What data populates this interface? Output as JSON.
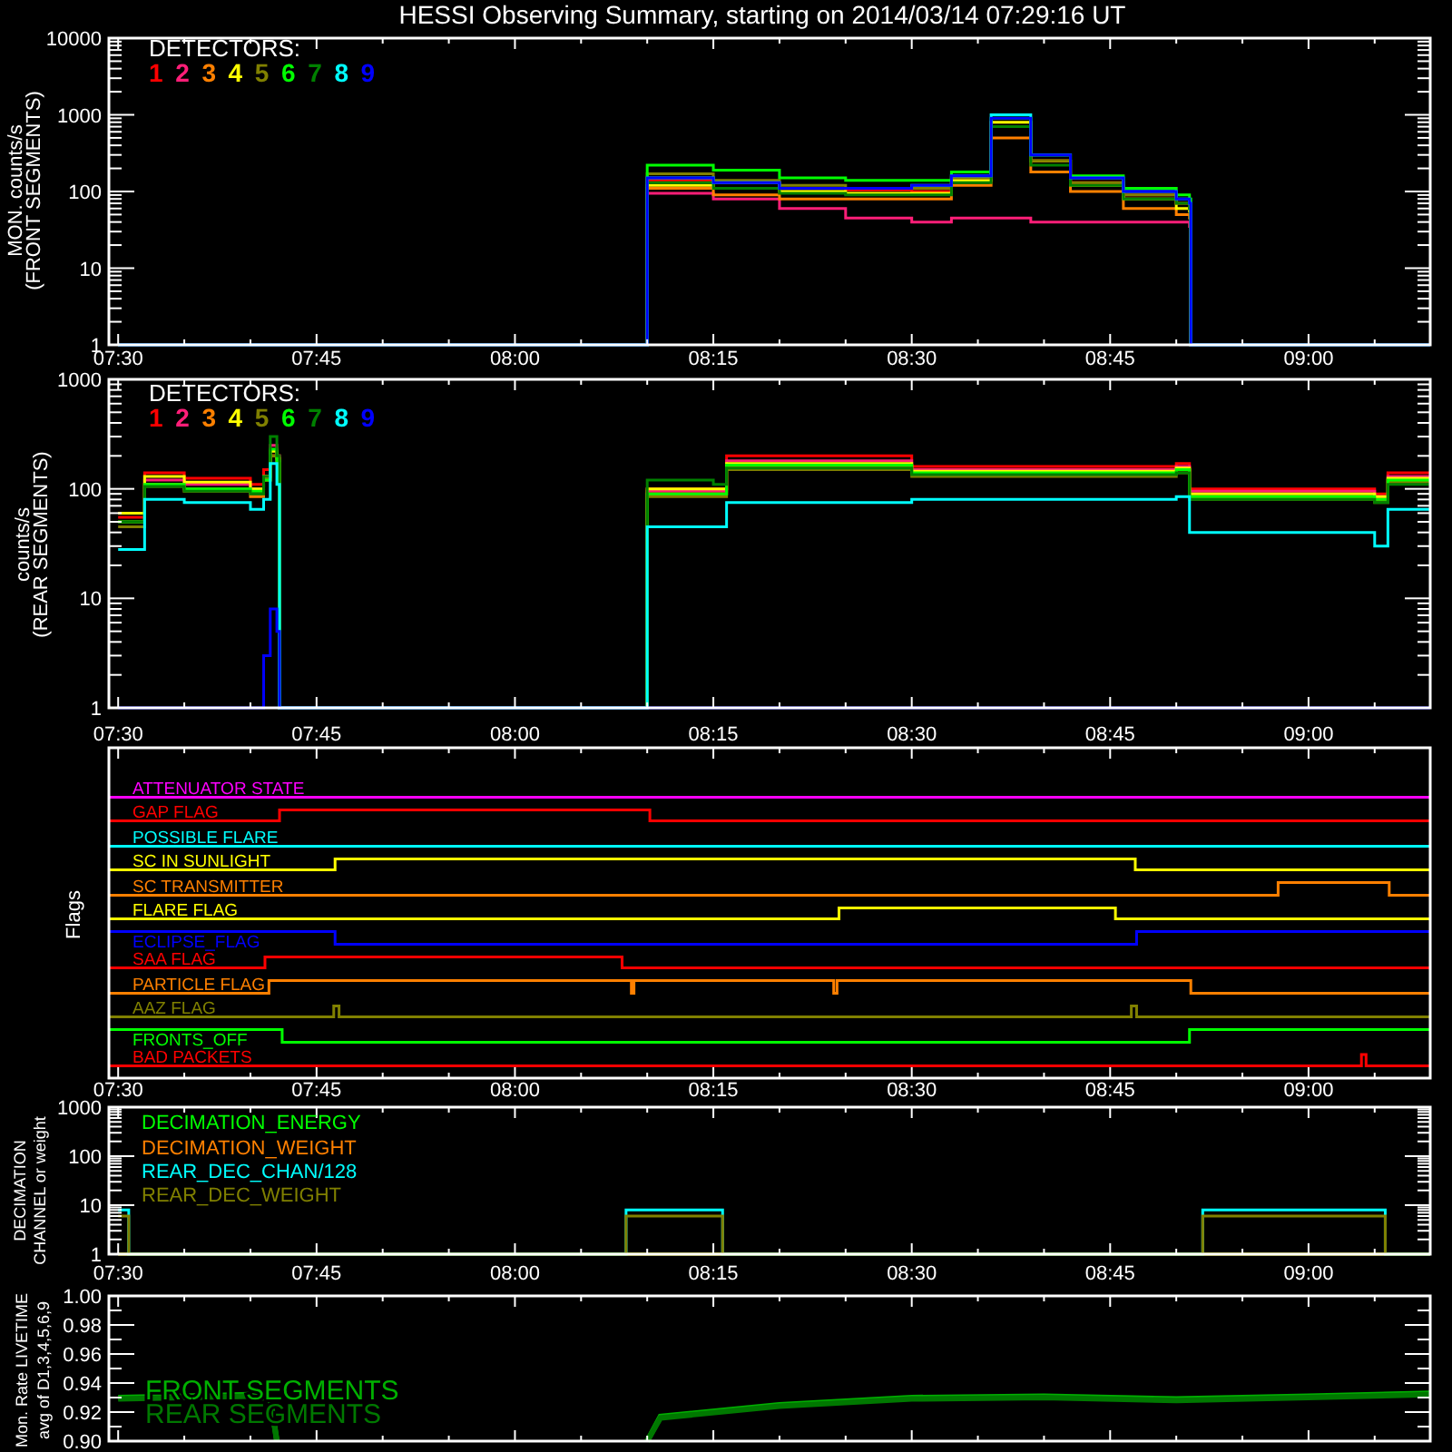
{
  "title": "HESSI Observing Summary, starting on 2014/03/14 07:29:16 UT",
  "panels": [
    {
      "kind": "curves",
      "ylabel": "MON. counts/s\n(FRONT SEGMENTS)",
      "y_tick_labels": [
        "10000",
        "1000",
        "100",
        "10",
        "1"
      ],
      "x_tick_labels": [
        "07:30",
        "07:45",
        "08:00",
        "08:15",
        "08:30",
        "08:45",
        "09:00"
      ],
      "legend": {
        "kind": "digits",
        "title": "DETECTORS:",
        "items": [
          {
            "label": "1",
            "color": "#ff0000"
          },
          {
            "label": "2",
            "color": "#ff1e78"
          },
          {
            "label": "3",
            "color": "#ff8000"
          },
          {
            "label": "4",
            "color": "#ffff00"
          },
          {
            "label": "5",
            "color": "#808000"
          },
          {
            "label": "6",
            "color": "#00ff00"
          },
          {
            "label": "7",
            "color": "#008000"
          },
          {
            "label": "8",
            "color": "#00ffff"
          },
          {
            "label": "9",
            "color": "#0000ff"
          }
        ]
      }
    },
    {
      "kind": "curves",
      "ylabel": "counts/s\n(REAR SEGMENTS)",
      "y_tick_labels": [
        "1000",
        "100",
        "10",
        "1"
      ],
      "x_tick_labels": [
        "07:30",
        "07:45",
        "08:00",
        "08:15",
        "08:30",
        "08:45",
        "09:00"
      ],
      "legend": {
        "kind": "digits",
        "title": "DETECTORS:",
        "items": [
          {
            "label": "1",
            "color": "#ff0000"
          },
          {
            "label": "2",
            "color": "#ff1e78"
          },
          {
            "label": "3",
            "color": "#ff8000"
          },
          {
            "label": "4",
            "color": "#ffff00"
          },
          {
            "label": "5",
            "color": "#808000"
          },
          {
            "label": "6",
            "color": "#00ff00"
          },
          {
            "label": "7",
            "color": "#008000"
          },
          {
            "label": "8",
            "color": "#00ffff"
          },
          {
            "label": "9",
            "color": "#0000ff"
          }
        ]
      }
    },
    {
      "kind": "flags",
      "ylabel": "Flags",
      "x_tick_labels": [
        "07:30",
        "07:45",
        "08:00",
        "08:15",
        "08:30",
        "08:45",
        "09:00"
      ],
      "flags": [
        {
          "label": "ATTENUATOR STATE",
          "color": "#ff00ff"
        },
        {
          "label": "GAP FLAG",
          "color": "#ff0000"
        },
        {
          "label": "POSSIBLE FLARE",
          "color": "#00ffff"
        },
        {
          "label": "SC IN SUNLIGHT",
          "color": "#ffff00"
        },
        {
          "label": "SC TRANSMITTER",
          "color": "#ff8000"
        },
        {
          "label": "FLARE FLAG",
          "color": "#ffff00"
        },
        {
          "label": "ECLIPSE_FLAG",
          "color": "#0000ff"
        },
        {
          "label": "SAA FLAG",
          "color": "#ff0000"
        },
        {
          "label": "PARTICLE FLAG",
          "color": "#ff8000"
        },
        {
          "label": "AAZ FLAG",
          "color": "#808000"
        },
        {
          "label": "FRONTS_OFF",
          "color": "#00ff00"
        },
        {
          "label": "BAD PACKETS",
          "color": "#ff0000"
        }
      ]
    },
    {
      "kind": "curves",
      "ylabel": "DECIMATION\nCHANNEL or weight",
      "y_tick_labels": [
        "1000",
        "100",
        "10",
        "1"
      ],
      "x_tick_labels": [
        "07:30",
        "07:45",
        "08:00",
        "08:15",
        "08:30",
        "08:45",
        "09:00"
      ],
      "legend": {
        "kind": "list",
        "items": [
          {
            "label": "DECIMATION_ENERGY",
            "color": "#00ff00"
          },
          {
            "label": "DECIMATION_WEIGHT",
            "color": "#ff8000"
          },
          {
            "label": "REAR_DEC_CHAN/128",
            "color": "#00ffff"
          },
          {
            "label": "REAR_DEC_WEIGHT",
            "color": "#808000"
          }
        ]
      }
    },
    {
      "kind": "curves",
      "ylabel": "Mon. Rate LIVETIME\navg of D1,3,4,5,6,9",
      "y_tick_labels": [
        "1.00",
        "0.98",
        "0.96",
        "0.94",
        "0.92",
        "0.90"
      ],
      "legend": {
        "kind": "large",
        "items": [
          {
            "label": "FRONT SEGMENTS",
            "color": "#00b000"
          },
          {
            "label": "REAR SEGMENTS",
            "color": "#007800"
          }
        ]
      }
    }
  ]
}
